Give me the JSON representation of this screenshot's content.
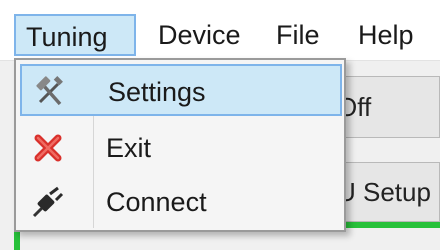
{
  "menubar": {
    "items": [
      {
        "label": "Tuning"
      },
      {
        "label": "Device"
      },
      {
        "label": "File"
      },
      {
        "label": "Help"
      }
    ]
  },
  "dropdown": {
    "items": [
      {
        "label": "Settings",
        "icon": "tools-icon"
      },
      {
        "label": "Exit",
        "icon": "red-x-icon"
      },
      {
        "label": "Connect",
        "icon": "plug-icon"
      }
    ]
  },
  "background": {
    "off_button_label": "Off",
    "setup_button_label": "U Setup"
  },
  "colors": {
    "highlight": "#cde8f7",
    "highlight_border": "#7eb4ea",
    "exit_red": "#d9302b",
    "status_green": "#27c13a"
  }
}
